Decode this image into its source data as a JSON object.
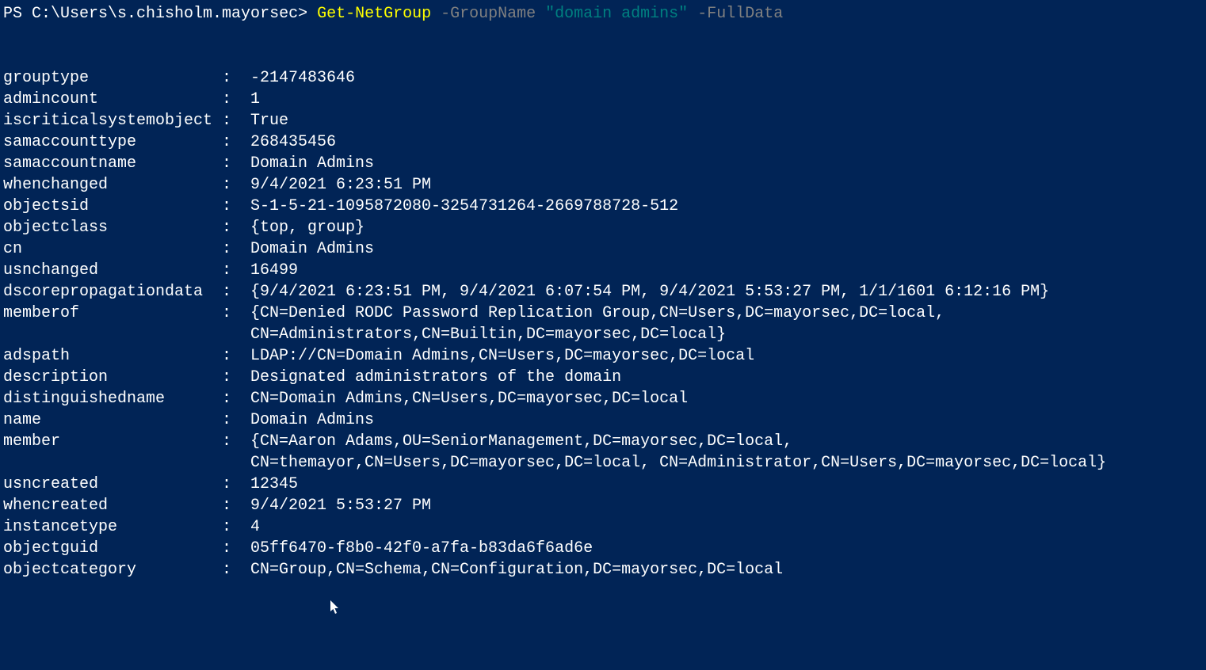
{
  "prompt": {
    "prefix": "PS ",
    "path": "C:\\Users\\s.chisholm.mayorsec",
    "arrow": "> ",
    "cmdlet": "Get-NetGroup",
    "param1": " -GroupName ",
    "string1": "\"domain admins\"",
    "param2": " -FullData"
  },
  "output": [
    {
      "key": "grouptype",
      "val": "-2147483646",
      "lines": 1
    },
    {
      "key": "admincount",
      "val": "1",
      "lines": 1
    },
    {
      "key": "iscriticalsystemobject",
      "val": "True",
      "lines": 1
    },
    {
      "key": "samaccounttype",
      "val": "268435456",
      "lines": 1
    },
    {
      "key": "samaccountname",
      "val": "Domain Admins",
      "lines": 1
    },
    {
      "key": "whenchanged",
      "val": "9/4/2021 6:23:51 PM",
      "lines": 1
    },
    {
      "key": "objectsid",
      "val": "S-1-5-21-1095872080-3254731264-2669788728-512",
      "lines": 1
    },
    {
      "key": "objectclass",
      "val": "{top, group}",
      "lines": 1
    },
    {
      "key": "cn",
      "val": "Domain Admins",
      "lines": 1
    },
    {
      "key": "usnchanged",
      "val": "16499",
      "lines": 1
    },
    {
      "key": "dscorepropagationdata",
      "val": "{9/4/2021 6:23:51 PM, 9/4/2021 6:07:54 PM, 9/4/2021 5:53:27 PM, 1/1/1601 6:12:16 PM}",
      "lines": 1
    },
    {
      "key": "memberof",
      "val": "{CN=Denied RODC Password Replication Group,CN=Users,DC=mayorsec,DC=local,\nCN=Administrators,CN=Builtin,DC=mayorsec,DC=local}",
      "lines": 2
    },
    {
      "key": "adspath",
      "val": "LDAP://CN=Domain Admins,CN=Users,DC=mayorsec,DC=local",
      "lines": 1
    },
    {
      "key": "description",
      "val": "Designated administrators of the domain",
      "lines": 1
    },
    {
      "key": "distinguishedname",
      "val": "CN=Domain Admins,CN=Users,DC=mayorsec,DC=local",
      "lines": 1
    },
    {
      "key": "name",
      "val": "Domain Admins",
      "lines": 1
    },
    {
      "key": "member",
      "val": "{CN=Aaron Adams,OU=SeniorManagement,DC=mayorsec,DC=local,\nCN=themayor,CN=Users,DC=mayorsec,DC=local, CN=Administrator,CN=Users,DC=mayorsec,DC=local}",
      "lines": 2
    },
    {
      "key": "usncreated",
      "val": "12345",
      "lines": 1
    },
    {
      "key": "whencreated",
      "val": "9/4/2021 5:53:27 PM",
      "lines": 1
    },
    {
      "key": "instancetype",
      "val": "4",
      "lines": 1
    },
    {
      "key": "objectguid",
      "val": "05ff6470-f8b0-42f0-a7fa-b83da6f6ad6e",
      "lines": 1
    },
    {
      "key": "objectcategory",
      "val": "CN=Group,CN=Schema,CN=Configuration,DC=mayorsec,DC=local",
      "lines": 1
    }
  ]
}
